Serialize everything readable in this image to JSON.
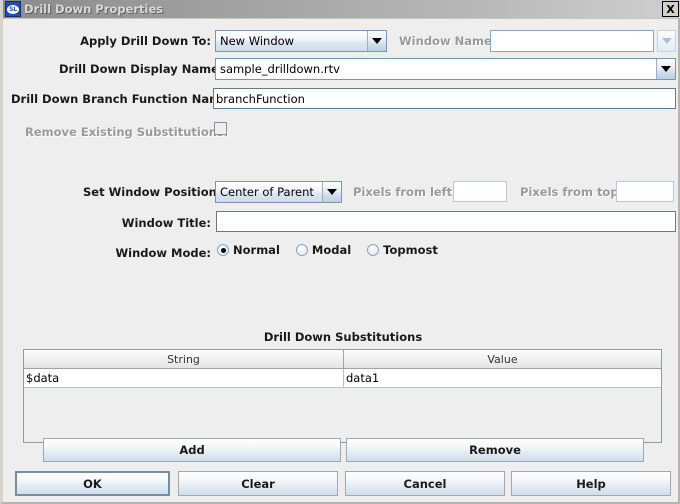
{
  "window": {
    "title": "Drill Down Properties",
    "logo_text": "SL",
    "close_label": "X"
  },
  "form": {
    "apply_label": "Apply Drill Down To:",
    "apply_value": "New Window",
    "window_name_label": "Window Name:",
    "window_name_value": "",
    "display_name_label": "Drill Down Display Name:",
    "display_name_value": "sample_drilldown.rtv",
    "branch_function_label": "Drill Down Branch Function Name:",
    "branch_function_value": "branchFunction",
    "remove_subs_label": "Remove Existing Substitutions:",
    "set_position_label": "Set Window Position:",
    "set_position_value": "Center of Parent",
    "pixels_left_label": "Pixels from left:",
    "pixels_left_value": "",
    "pixels_top_label": "Pixels from top:",
    "pixels_top_value": "",
    "window_title_label": "Window Title:",
    "window_title_value": "",
    "window_mode_label": "Window Mode:",
    "window_mode_options": [
      "Normal",
      "Modal",
      "Topmost"
    ],
    "window_mode_selected": "Normal"
  },
  "substitutions": {
    "section_title": "Drill Down Substitutions",
    "columns": [
      "String",
      "Value"
    ],
    "rows": [
      {
        "string": "$data",
        "value": "data1"
      }
    ]
  },
  "buttons": {
    "add": "Add",
    "remove": "Remove",
    "ok": "OK",
    "clear": "Clear",
    "cancel": "Cancel",
    "help": "Help"
  }
}
